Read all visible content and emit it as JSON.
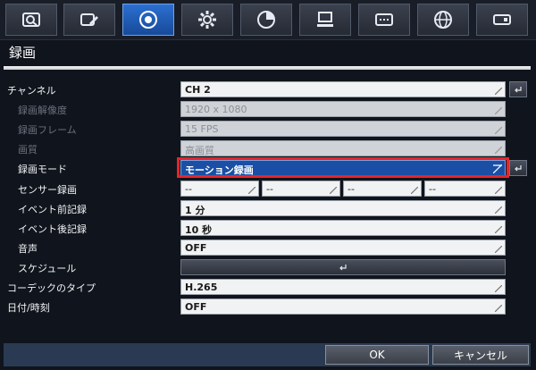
{
  "tabs": [
    {
      "icon": "camera-search-icon"
    },
    {
      "icon": "video-edit-icon"
    },
    {
      "icon": "record-icon",
      "active": true
    },
    {
      "icon": "gear-icon"
    },
    {
      "icon": "pie-chart-icon"
    },
    {
      "icon": "computer-icon"
    },
    {
      "icon": "display-icon"
    },
    {
      "icon": "globe-icon"
    },
    {
      "icon": "storage-icon"
    }
  ],
  "page": {
    "title": "録画"
  },
  "rows": {
    "channel": {
      "label": "チャンネル",
      "value": "CH 2"
    },
    "resolution": {
      "label": "録画解像度",
      "value": "1920 x 1080"
    },
    "frame": {
      "label": "録画フレーム",
      "value": "15 FPS"
    },
    "quality": {
      "label": "画質",
      "value": "高画質"
    },
    "mode": {
      "label": "録画モード",
      "value": "モーション録画"
    },
    "sensor": {
      "label": "センサー録画",
      "values": [
        "--",
        "--",
        "--",
        "--"
      ]
    },
    "pre_event": {
      "label": "イベント前記録",
      "value": "1 分"
    },
    "post_event": {
      "label": "イベント後記録",
      "value": "10 秒"
    },
    "audio": {
      "label": "音声",
      "value": "OFF"
    },
    "schedule": {
      "label": "スケジュール"
    },
    "codec": {
      "label": "コーデックのタイプ",
      "value": "H.265"
    },
    "datetime": {
      "label": "日付/時刻",
      "value": "OFF"
    }
  },
  "footer": {
    "ok": "OK",
    "cancel": "キャンセル"
  },
  "colors": {
    "active_tab": "#1f5fc0",
    "highlight_outline": "#e3262b",
    "highlight_field": "#1a4fa5"
  }
}
